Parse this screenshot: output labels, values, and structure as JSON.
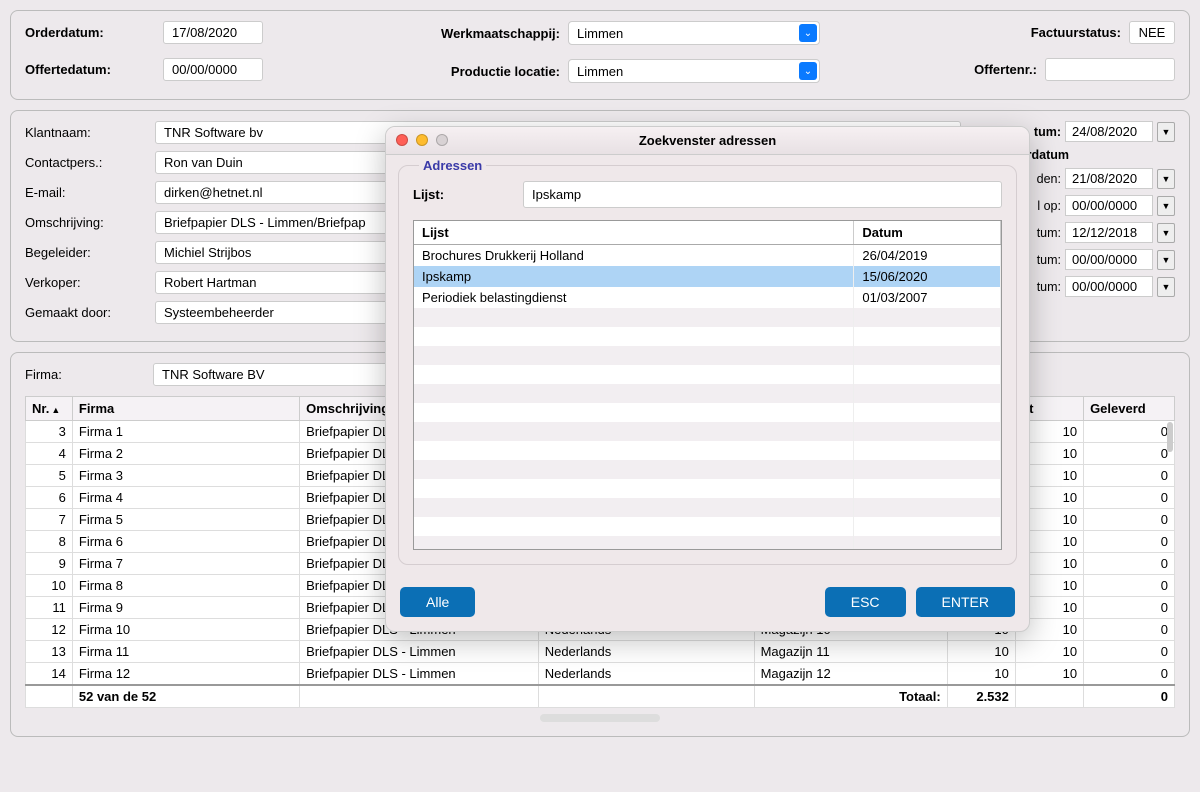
{
  "top": {
    "orderdatum_label": "Orderdatum:",
    "orderdatum": "17/08/2020",
    "offertedatum_label": "Offertedatum:",
    "offertedatum": "00/00/0000",
    "werkmaatschappij_label": "Werkmaatschappij:",
    "werkmaatschappij": "Limmen",
    "productielocatie_label": "Productie locatie:",
    "productielocatie": "Limmen",
    "factuurstatus_label": "Factuurstatus:",
    "factuurstatus": "NEE",
    "offertenr_label": "Offertenr.:",
    "offertenr": ""
  },
  "details": {
    "klantnaam_label": "Klantnaam:",
    "klantnaam": "TNR Software bv",
    "contactpers_label": "Contactpers.:",
    "contactpers": "Ron van Duin",
    "email_label": "E-mail:",
    "email": "dirken@hetnet.nl",
    "omschrijving_label": "Omschrijving:",
    "omschrijving": "Briefpapier DLS - Limmen/Briefpap",
    "begeleider_label": "Begeleider:",
    "begeleider": "Michiel Strijbos",
    "verkoper_label": "Verkoper:",
    "verkoper": "Robert Hartman",
    "gemaaktdoor_label": "Gemaakt door:",
    "gemaaktdoor": "Systeembeheerder"
  },
  "dates": {
    "r1_label": "tum:",
    "r1": "24/08/2020",
    "r2_label": "ste leverdatum",
    "r3_label": "den:",
    "r3": "21/08/2020",
    "r4_label": "l op:",
    "r4": "00/00/0000",
    "r5_label": "tum:",
    "r5": "12/12/2018",
    "r6_label": "tum:",
    "r6": "00/00/0000",
    "r7_label": "tum:",
    "r7": "00/00/0000"
  },
  "firma": {
    "label": "Firma:",
    "value": "TNR Software BV"
  },
  "grid": {
    "headers": {
      "nr": "Nr.",
      "firma": "Firma",
      "omschrijving": "Omschrijving",
      "lang": "",
      "magazijn": "",
      "col1": "",
      "kt": "kt",
      "geleverd": "Geleverd"
    },
    "rows": [
      {
        "nr": "3",
        "firma": "Firma 1",
        "oms": "Briefpapier DLS",
        "lang": "",
        "mag": "",
        "c1": "",
        "kt": "10",
        "gel": "0"
      },
      {
        "nr": "4",
        "firma": "Firma 2",
        "oms": "Briefpapier DLS",
        "lang": "",
        "mag": "",
        "c1": "",
        "kt": "10",
        "gel": "0"
      },
      {
        "nr": "5",
        "firma": "Firma 3",
        "oms": "Briefpapier DLS",
        "lang": "",
        "mag": "",
        "c1": "",
        "kt": "10",
        "gel": "0"
      },
      {
        "nr": "6",
        "firma": "Firma 4",
        "oms": "Briefpapier DLS",
        "lang": "",
        "mag": "",
        "c1": "",
        "kt": "10",
        "gel": "0"
      },
      {
        "nr": "7",
        "firma": "Firma 5",
        "oms": "Briefpapier DLS",
        "lang": "",
        "mag": "",
        "c1": "",
        "kt": "10",
        "gel": "0"
      },
      {
        "nr": "8",
        "firma": "Firma 6",
        "oms": "Briefpapier DLS",
        "lang": "",
        "mag": "",
        "c1": "",
        "kt": "10",
        "gel": "0"
      },
      {
        "nr": "9",
        "firma": "Firma 7",
        "oms": "Briefpapier DLS",
        "lang": "",
        "mag": "",
        "c1": "",
        "kt": "10",
        "gel": "0"
      },
      {
        "nr": "10",
        "firma": "Firma 8",
        "oms": "Briefpapier DLS",
        "lang": "",
        "mag": "",
        "c1": "",
        "kt": "10",
        "gel": "0"
      },
      {
        "nr": "11",
        "firma": "Firma 9",
        "oms": "Briefpapier DLS",
        "lang": "",
        "mag": "",
        "c1": "",
        "kt": "10",
        "gel": "0"
      },
      {
        "nr": "12",
        "firma": "Firma 10",
        "oms": "Briefpapier DLS - Limmen",
        "lang": "Nederlands",
        "mag": "Magazijn 10",
        "c1": "10",
        "kt": "10",
        "gel": "0"
      },
      {
        "nr": "13",
        "firma": "Firma 11",
        "oms": "Briefpapier DLS - Limmen",
        "lang": "Nederlands",
        "mag": "Magazijn 11",
        "c1": "10",
        "kt": "10",
        "gel": "0"
      },
      {
        "nr": "14",
        "firma": "Firma 12",
        "oms": "Briefpapier DLS - Limmen",
        "lang": "Nederlands",
        "mag": "Magazijn 12",
        "c1": "10",
        "kt": "10",
        "gel": "0"
      }
    ],
    "footer": {
      "count": "52 van de 52",
      "totaal_label": "Totaal:",
      "totaal": "2.532",
      "kt_total": "",
      "gel_total": "0"
    }
  },
  "modal": {
    "title": "Zoekvenster adressen",
    "legend": "Adressen",
    "lijst_label": "Lijst:",
    "lijst_value": "Ipskamp",
    "headers": {
      "lijst": "Lijst",
      "datum": "Datum"
    },
    "rows": [
      {
        "lijst": "Brochures Drukkerij Holland",
        "datum": "26/04/2019",
        "selected": false
      },
      {
        "lijst": "Ipskamp",
        "datum": "15/06/2020",
        "selected": true
      },
      {
        "lijst": "Periodiek belastingdienst",
        "datum": "01/03/2007",
        "selected": false
      }
    ],
    "alle": "Alle",
    "esc": "ESC",
    "enter": "ENTER"
  }
}
